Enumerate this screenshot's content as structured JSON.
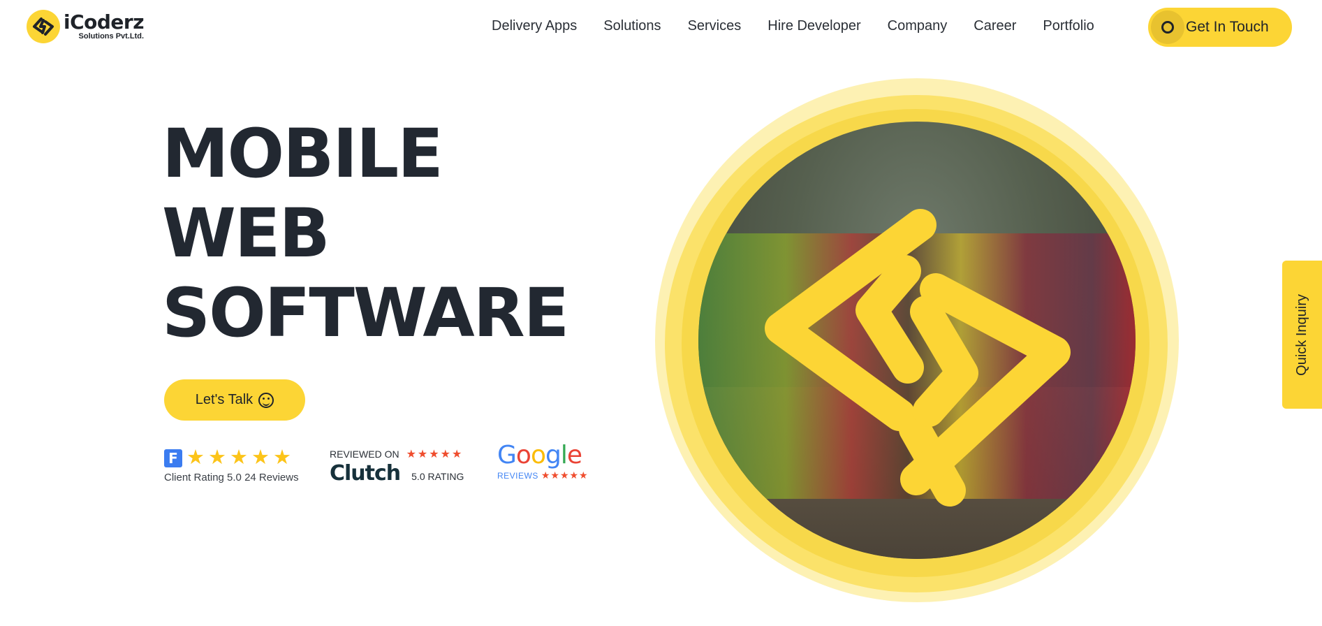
{
  "brand": {
    "name": "iCoderz",
    "subtitle": "Solutions Pvt.Ltd.",
    "accent_color": "#fcd535",
    "dark_color": "#222831"
  },
  "nav": {
    "items": [
      {
        "label": "Delivery Apps"
      },
      {
        "label": "Solutions"
      },
      {
        "label": "Services"
      },
      {
        "label": "Hire Developer"
      },
      {
        "label": "Company"
      },
      {
        "label": "Career"
      },
      {
        "label": "Portfolio"
      }
    ],
    "cta_label": "Get In Touch"
  },
  "hero": {
    "lines": [
      "MOBILE",
      "WEB",
      "SOFTWARE"
    ],
    "button_label": "Let's Talk",
    "button_icon": "smiley-icon"
  },
  "ratings": {
    "goodfirms": {
      "icon": "goodfirms-logo-icon",
      "stars": 5,
      "caption": "Client  Rating 5.0 24 Reviews"
    },
    "clutch": {
      "reviewed_on": "REVIEWED ON",
      "name": "Clutch",
      "rating": "5.0  RATING",
      "stars": 5
    },
    "google": {
      "name": "Google",
      "reviews_label": "REVIEWS",
      "stars": 5
    }
  },
  "hero_image": {
    "icon": "icoderz-emblem-icon"
  },
  "quick_inquiry": {
    "label": "Quick Inquiry"
  }
}
